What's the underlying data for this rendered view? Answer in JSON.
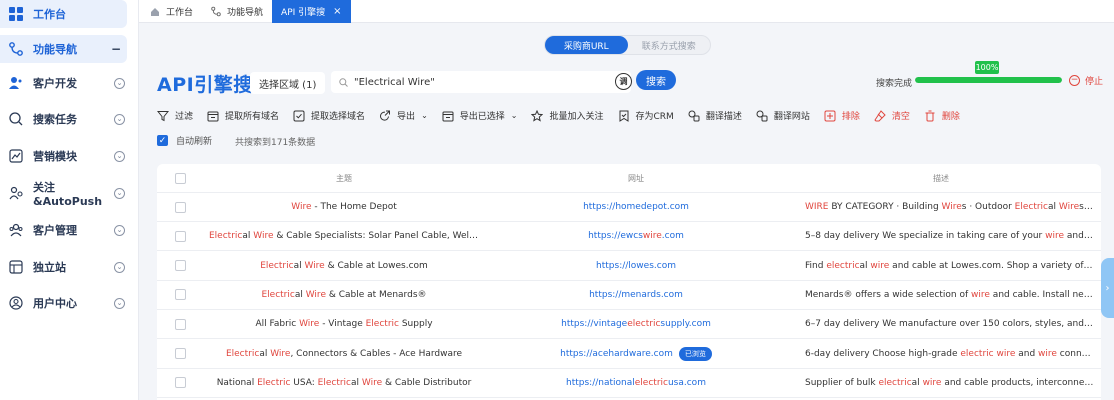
{
  "sidebar": {
    "items": [
      {
        "label": "工作台",
        "icon": "dashboard-icon"
      },
      {
        "label": "功能导航",
        "icon": "navigation-icon"
      },
      {
        "label": "客户开发",
        "icon": "customer-dev-icon"
      },
      {
        "label": "搜索任务",
        "icon": "search-task-icon"
      },
      {
        "label": "营销模块",
        "icon": "marketing-icon"
      },
      {
        "label": "关注&AutoPush",
        "icon": "follow-icon"
      },
      {
        "label": "客户管理",
        "icon": "customer-manage-icon"
      },
      {
        "label": "独立站",
        "icon": "website-icon"
      },
      {
        "label": "用户中心",
        "icon": "user-center-icon"
      }
    ]
  },
  "tabs": [
    {
      "label": "工作台"
    },
    {
      "label": "功能导航"
    },
    {
      "label": "API 引擎搜",
      "close": "×"
    }
  ],
  "mode": {
    "active": "采购商URL",
    "inactive": "联系方式搜索"
  },
  "brand": "API引擎搜",
  "region": {
    "label": "选择区域 (1)"
  },
  "search": {
    "value": "\"Electrical Wire\"",
    "tone_label": "调",
    "button": "搜索"
  },
  "progress": {
    "label": "搜索完成",
    "percent_text": "100%",
    "value": 1.0,
    "stop_label": "停止"
  },
  "toolbar": {
    "filter": "过滤",
    "extract_all": "提取所有域名",
    "extract_sel": "提取选择域名",
    "export": "导出",
    "export_sel": "导出已选择",
    "batch_follow": "批量加入关注",
    "save_crm": "存为CRM",
    "translate_desc": "翻译描述",
    "translate_site": "翻译网站",
    "exclude": "排除",
    "clear": "清空",
    "delete": "删除"
  },
  "auto_refresh": "自动刷新",
  "result_count": "共搜索到171条数据",
  "table": {
    "headers": {
      "subject": "主题",
      "url": "网址",
      "desc": "描述"
    },
    "rows": [
      {
        "subject": [
          [
            "Wire",
            1
          ],
          [
            " - The Home Depot",
            0
          ]
        ],
        "url": [
          [
            "https://homedepot.com",
            0
          ]
        ],
        "badge": "",
        "desc": [
          [
            "WIRE",
            1
          ],
          [
            " BY CATEGORY · Building ",
            0
          ],
          [
            "Wire",
            1
          ],
          [
            "s · Outdoor ",
            0
          ],
          [
            "Electric",
            1
          ],
          [
            "al ",
            0
          ],
          [
            "Wire",
            1
          ],
          [
            "s · S...",
            0
          ]
        ]
      },
      {
        "subject": [
          [
            "Electric",
            1
          ],
          [
            "al ",
            0
          ],
          [
            "Wire",
            1
          ],
          [
            " & Cable Specialists: Solar Panel Cable, Welding Ca...",
            0
          ]
        ],
        "url": [
          [
            "https://ewcs",
            0
          ],
          [
            "wire",
            1
          ],
          [
            ".com",
            0
          ]
        ],
        "badge": "",
        "desc": [
          [
            "5–8 day delivery We specialize in taking care of your ",
            0
          ],
          [
            "wire",
            1
          ],
          [
            " and ca...",
            0
          ]
        ]
      },
      {
        "subject": [
          [
            "Electric",
            1
          ],
          [
            "al ",
            0
          ],
          [
            "Wire",
            1
          ],
          [
            " & Cable at Lowes.com",
            0
          ]
        ],
        "url": [
          [
            "https://lowes.com",
            0
          ]
        ],
        "badge": "",
        "desc": [
          [
            "Find ",
            0
          ],
          [
            "electric",
            1
          ],
          [
            "al ",
            0
          ],
          [
            "wire",
            1
          ],
          [
            " and cable at Lowes.com. Shop a variety of pro...",
            0
          ]
        ]
      },
      {
        "subject": [
          [
            "Electric",
            1
          ],
          [
            "al ",
            0
          ],
          [
            "Wire",
            1
          ],
          [
            " & Cable at Menards®",
            0
          ]
        ],
        "url": [
          [
            "https://menards.com",
            0
          ]
        ],
        "badge": "",
        "desc": [
          [
            "Menards® offers a wide selection of ",
            0
          ],
          [
            "wire",
            1
          ],
          [
            " and cable. Install new c...",
            0
          ]
        ]
      },
      {
        "subject": [
          [
            "All Fabric ",
            0
          ],
          [
            "Wire",
            1
          ],
          [
            " - Vintage ",
            0
          ],
          [
            "Electric",
            1
          ],
          [
            " Supply",
            0
          ]
        ],
        "url": [
          [
            "https://vintage",
            0
          ],
          [
            "electric",
            1
          ],
          [
            "supply.com",
            0
          ]
        ],
        "badge": "",
        "desc": [
          [
            "6–7 day delivery We manufacture over 150 colors, styles, and pat...",
            0
          ]
        ]
      },
      {
        "subject": [
          [
            "Electric",
            1
          ],
          [
            "al ",
            0
          ],
          [
            "Wire",
            1
          ],
          [
            ", Connectors & Cables - Ace Hardware",
            0
          ]
        ],
        "url": [
          [
            "https://acehardware.com",
            0
          ]
        ],
        "badge": "已浏览",
        "desc": [
          [
            "6-day delivery Choose high-grade ",
            0
          ],
          [
            "electric",
            1
          ],
          [
            " ",
            0
          ],
          [
            "wire",
            1
          ],
          [
            " and ",
            0
          ],
          [
            "wire",
            1
          ],
          [
            " connect...",
            0
          ]
        ]
      },
      {
        "subject": [
          [
            "National ",
            0
          ],
          [
            "Electric",
            1
          ],
          [
            " USA: ",
            0
          ],
          [
            "Electric",
            1
          ],
          [
            "al ",
            0
          ],
          [
            "Wire",
            1
          ],
          [
            " & Cable Distributor",
            0
          ]
        ],
        "url": [
          [
            "https://national",
            0
          ],
          [
            "electric",
            1
          ],
          [
            "usa.com",
            0
          ]
        ],
        "badge": "",
        "desc": [
          [
            "Supplier of bulk ",
            0
          ],
          [
            "electric",
            1
          ],
          [
            "al ",
            0
          ],
          [
            "wire",
            1
          ],
          [
            " and cable products, interconnect, ...",
            0
          ]
        ]
      }
    ]
  },
  "colors": {
    "accent": "#1f6bdc",
    "highlight": "#e0463e",
    "success": "#21c14b"
  }
}
